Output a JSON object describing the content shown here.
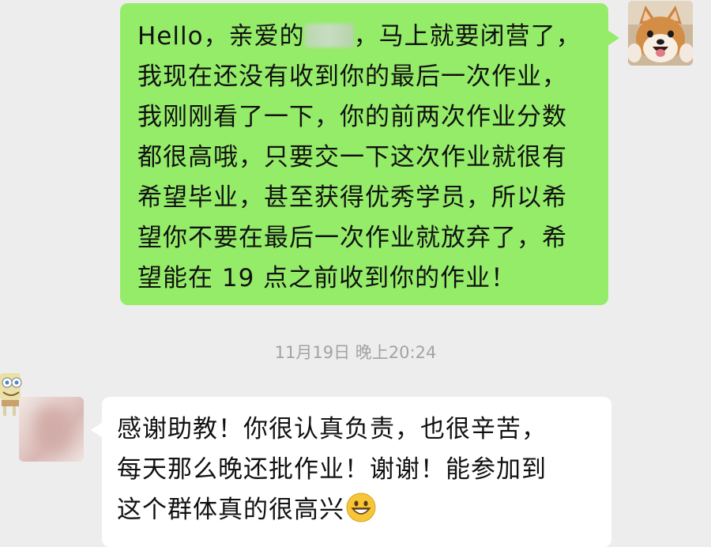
{
  "messages": {
    "outgoing": {
      "line1_a": "Hello，亲爱的",
      "line1_b": "，马上就要闭营了，",
      "line2": "我现在还没有收到你的最后一次作业，",
      "line3": "我刚刚看了一下，你的前两次作业分数",
      "line4": "都很高哦，只要交一下这次作业就很有",
      "line5": "希望毕业，甚至获得优秀学员，所以希",
      "line6": "望你不要在最后一次作业就放弃了，希",
      "line7": "望能在 19 点之前收到你的作业！"
    },
    "timestamp": "11月19日 晚上20:24",
    "incoming": {
      "line1": "感谢助教！你很认真负责，也很辛苦，",
      "line2": "每天那么晚还批作业！谢谢！能参加到",
      "line3": "这个群体真的很高兴",
      "emoji": "grinning-face-emoji"
    }
  },
  "colors": {
    "background": "#ededed",
    "outgoing_bubble": "#95ec69",
    "incoming_bubble": "#ffffff",
    "timestamp_text": "#a3a3a3"
  }
}
